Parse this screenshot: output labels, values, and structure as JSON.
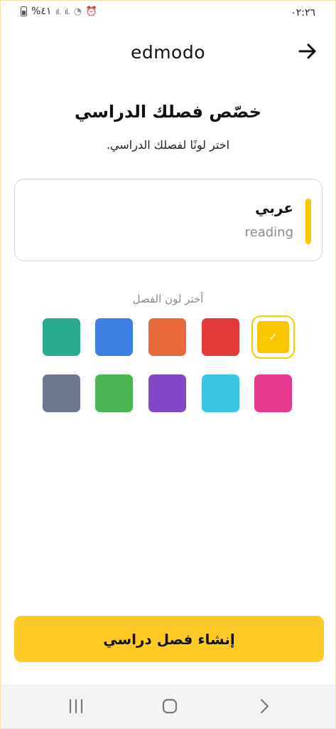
{
  "status_bar": {
    "time": "٠٢:٢٦",
    "battery_percent": "%٤١",
    "signal_icons": [
      "signal-1-icon",
      "signal-2-icon"
    ],
    "wifi_icon": "wifi-icon",
    "alarm_icon": "alarm-icon"
  },
  "header": {
    "logo": "edmodo",
    "next_icon": "arrow-right-icon"
  },
  "title": "خصّص فصلك الدراسي",
  "subtitle": "اختر لونًا لفصلك الدراسي.",
  "preview": {
    "class_name": "عربي",
    "class_description": "reading",
    "accent_color": "#fbc800"
  },
  "color_picker": {
    "label": "أختر لون الفصل",
    "selected_index": 0,
    "swatches": [
      "#fbc800",
      "#e43a3a",
      "#e8693a",
      "#3b7fe0",
      "#2aab8f",
      "#e63a8e",
      "#38c6e2",
      "#8745c7",
      "#4cb655",
      "#6e7790"
    ]
  },
  "create_button": {
    "label": "إنشاء فصل دراسي"
  },
  "nav_bar": {
    "icons": [
      "recent-apps-icon",
      "home-icon",
      "back-icon"
    ]
  }
}
